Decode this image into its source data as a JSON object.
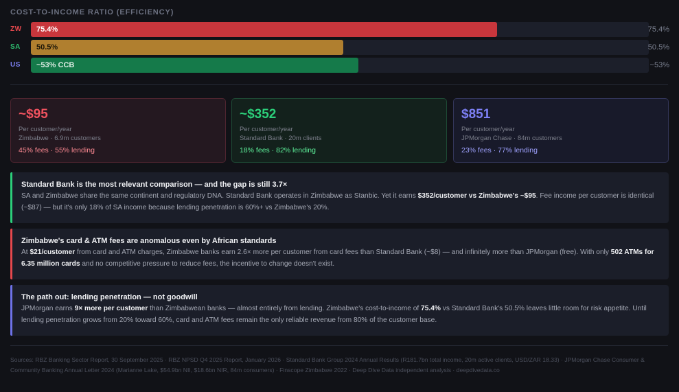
{
  "section_title": "COST-TO-INCOME RATIO (EFFICIENCY)",
  "bars": [
    {
      "code": "ZW",
      "label": "75.4%",
      "value_text": "75.4%",
      "value": 75.4,
      "color": "#c8363c",
      "code_color": "#e5484d",
      "text_color": "#ffffff"
    },
    {
      "code": "SA",
      "label": "50.5%",
      "value_text": "50.5%",
      "value": 50.5,
      "color": "#b07f2f",
      "code_color": "#2fbf71",
      "text_color": "#1a1608"
    },
    {
      "code": "US",
      "label": "~53% CCB",
      "value_text": "~53%",
      "value": 53,
      "color": "#157a4a",
      "code_color": "#7b7ff0",
      "text_color": "#dcebe2"
    }
  ],
  "cards": [
    {
      "amount": "~$95",
      "label": "Per customer/year",
      "sub": "Zimbabwe · 6.9m customers",
      "split": "45% fees · 55% lending",
      "accent": "#f0525f",
      "split_color": "#ff8a93",
      "bg": "#241820",
      "border": "#4f2530"
    },
    {
      "amount": "~$352",
      "label": "Per customer/year",
      "sub": "Standard Bank · 20m clients",
      "split": "18% fees · 82% lending",
      "accent": "#2ccf7a",
      "split_color": "#5ef29b",
      "bg": "#13211c",
      "border": "#1e4a35"
    },
    {
      "amount": "$851",
      "label": "Per customer/year",
      "sub": "JPMorgan Chase · 84m customers",
      "split": "23% fees · 77% lending",
      "accent": "#7d80f5",
      "split_color": "#9fa2ff",
      "bg": "#181a2a",
      "border": "#33365a"
    }
  ],
  "notes": [
    {
      "title": "Standard Bank is the most relevant comparison — and the gap is still 3.7×",
      "color": "#2ccf7a",
      "body": [
        {
          "t": "SA and Zimbabwe share the same continent and regulatory DNA. Standard Bank operates in Zimbabwe as Stanbic. Yet it earns ",
          "b": false
        },
        {
          "t": "$352/customer vs Zimbabwe's ~$95",
          "b": true
        },
        {
          "t": ". Fee income per customer is identical (~$87) — but it's only 18% of SA income because lending penetration is 60%+ vs Zimbabwe's 20%.",
          "b": false
        }
      ]
    },
    {
      "title": "Zimbabwe's card & ATM fees are anomalous even by African standards",
      "color": "#e5484d",
      "body": [
        {
          "t": "At ",
          "b": false
        },
        {
          "t": "$21/customer",
          "b": true
        },
        {
          "t": " from card and ATM charges, Zimbabwe banks earn 2.6× more per customer from card fees than Standard Bank (~$8) — and infinitely more than JPMorgan (free). With only ",
          "b": false
        },
        {
          "t": "502 ATMs for 6.35 million cards",
          "b": true
        },
        {
          "t": " and no competitive pressure to reduce fees, the incentive to change doesn't exist.",
          "b": false
        }
      ]
    },
    {
      "title": "The path out: lending penetration — not goodwill",
      "color": "#6e72e8",
      "body": [
        {
          "t": "JPMorgan earns ",
          "b": false
        },
        {
          "t": "9× more per customer",
          "b": true
        },
        {
          "t": " than Zimbabwean banks — almost entirely from lending. Zimbabwe's cost-to-income of ",
          "b": false
        },
        {
          "t": "75.4%",
          "b": true
        },
        {
          "t": " vs Standard Bank's 50.5% leaves little room for risk appetite. Until lending penetration grows from 20% toward 60%, card and ATM fees remain the only reliable revenue from 80% of the customer base.",
          "b": false
        }
      ]
    }
  ],
  "footer": "Sources: RBZ Banking Sector Report, 30 September 2025 · RBZ NPSD Q4 2025 Report, January 2026 · Standard Bank Group 2024 Annual Results (R181.7bn total income, 20m active clients, USD/ZAR 18.33) · JPMorgan Chase Consumer & Community Banking Annual Letter 2024 (Marianne Lake, $54.9bn NII, $18.6bn NIR, 84m consumers) · Finscope Zimbabwe 2022 · Deep Dive Data independent analysis · deepdivedata.co"
}
